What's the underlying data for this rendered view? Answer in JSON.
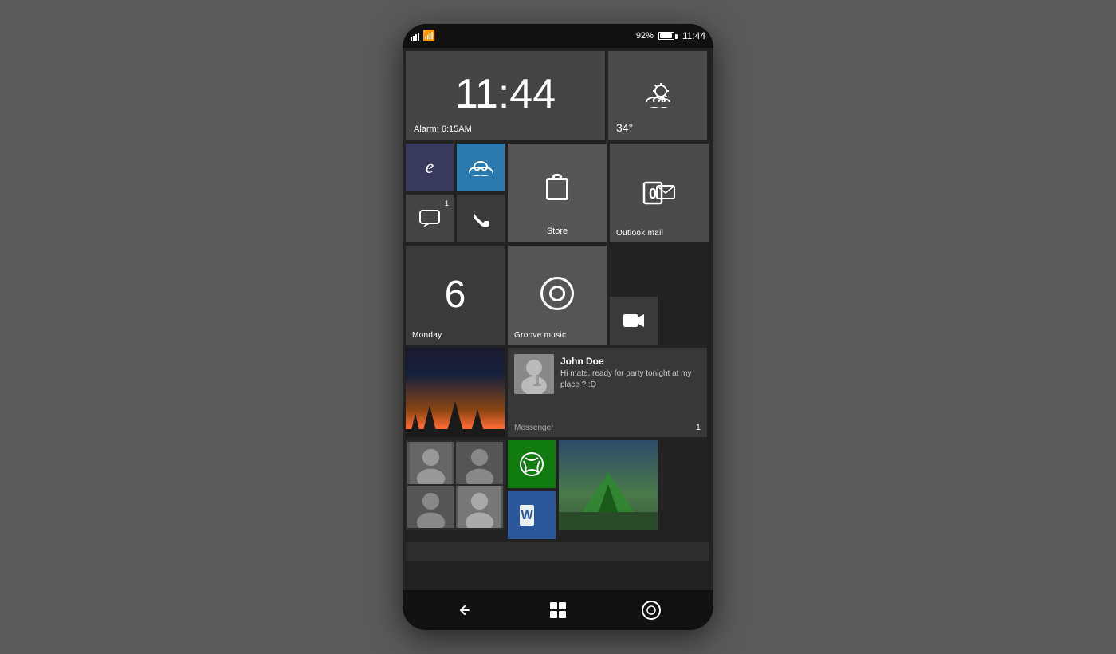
{
  "phone": {
    "status_bar": {
      "battery_percent": "92%",
      "time": "11:44"
    },
    "tiles": {
      "clock": {
        "time": "11:44",
        "alarm": "Alarm: 6:15AM"
      },
      "weather": {
        "temperature": "34°"
      },
      "messaging": {
        "badge": "1"
      },
      "store": {
        "label": "Store"
      },
      "outlook": {
        "label": "Outlook mail"
      },
      "calendar": {
        "day_number": "6",
        "day_name": "Monday"
      },
      "groove": {
        "label": "Groove music"
      },
      "messenger": {
        "contact_name": "John Doe",
        "message": "Hi mate, ready for party tonight at my place ? :D",
        "app_label": "Messenger",
        "count": "1"
      }
    },
    "nav": {
      "back_label": "←",
      "windows_label": "⊞",
      "cortana_label": "○"
    }
  }
}
